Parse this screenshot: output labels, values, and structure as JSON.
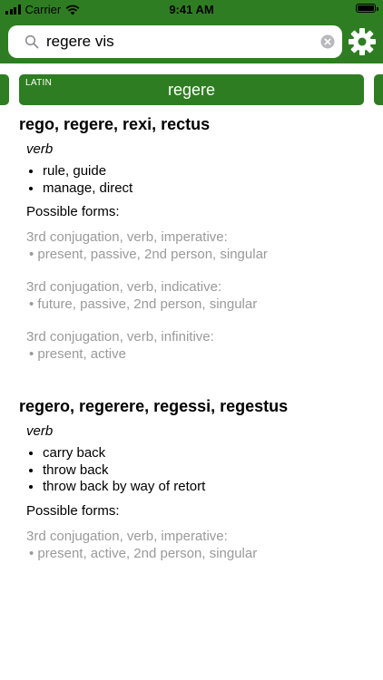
{
  "status_bar": {
    "carrier": "Carrier",
    "time": "9:41 AM"
  },
  "search": {
    "value": "regere vis"
  },
  "icons": {
    "search": "search-icon",
    "clear": "clear-icon",
    "settings": "gear-icon"
  },
  "colors": {
    "accent": "#2f7d22",
    "muted": "#9a9a9a"
  },
  "tab": {
    "language": "LATIN",
    "term": "regere"
  },
  "entries": [
    {
      "head": "rego, regere, rexi, rectus",
      "pos": "verb",
      "definitions": [
        "rule, guide",
        "manage, direct"
      ],
      "forms_title": "Possible forms:",
      "forms": [
        {
          "type": "3rd conjugation, verb, imperative:",
          "detail": "present, passive, 2nd person, singular"
        },
        {
          "type": "3rd conjugation, verb, indicative:",
          "detail": "future, passive, 2nd person, singular"
        },
        {
          "type": "3rd conjugation, verb, infinitive:",
          "detail": "present, active"
        }
      ]
    },
    {
      "head": "regero, regerere, regessi, regestus",
      "pos": "verb",
      "definitions": [
        "carry back",
        "throw back",
        "throw back by way of retort"
      ],
      "forms_title": "Possible forms:",
      "forms": [
        {
          "type": "3rd conjugation, verb, imperative:",
          "detail": "present, active, 2nd person, singular"
        }
      ]
    }
  ]
}
